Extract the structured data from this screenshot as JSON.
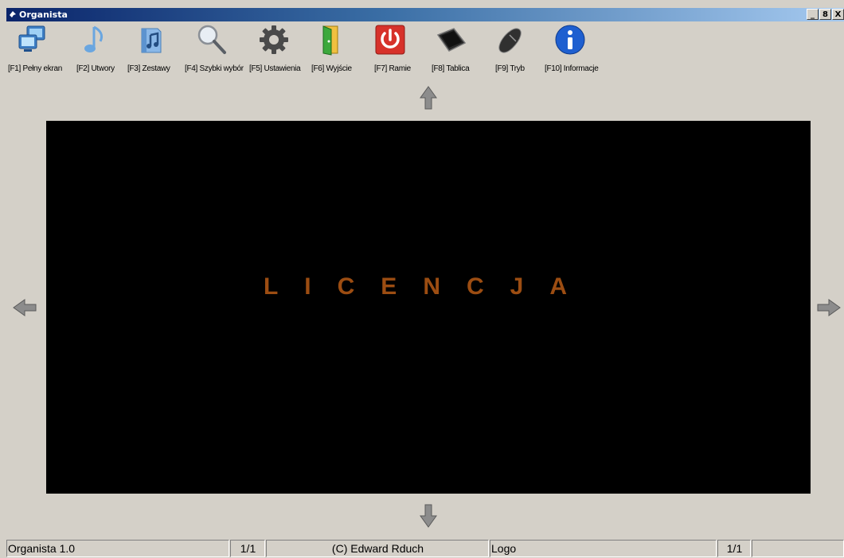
{
  "window": {
    "title": "Organista",
    "controls": {
      "minimize": "_",
      "maximize": "8",
      "close": "X"
    }
  },
  "toolbar": {
    "items": [
      {
        "label": "[F1] Pełny ekran",
        "icon": "monitors-icon"
      },
      {
        "label": "[F2] Utwory",
        "icon": "music-note-icon"
      },
      {
        "label": "[F3] Zestawy",
        "icon": "music-folder-icon"
      },
      {
        "label": "[F4] Szybki wybór",
        "icon": "magnifier-icon"
      },
      {
        "label": "[F5] Ustawienia",
        "icon": "gear-icon"
      },
      {
        "label": "[F6] Wyjście",
        "icon": "door-icon"
      },
      {
        "label": "[F7] Ramie",
        "icon": "power-icon"
      },
      {
        "label": "[F8] Tablica",
        "icon": "tablet-icon"
      },
      {
        "label": "[F9] Tryb",
        "icon": "mouse-icon"
      },
      {
        "label": "[F10] Informacje",
        "icon": "info-icon"
      }
    ]
  },
  "navigation": {
    "up": "arrow-up-icon",
    "down": "arrow-down-icon",
    "left": "arrow-left-icon",
    "right": "arrow-right-icon"
  },
  "screen": {
    "text": "LICENCJA",
    "text_color": "#9c4d12",
    "background": "#000000"
  },
  "status_bar": {
    "app_name": "Organista 1.0",
    "page_left": "1/1",
    "copyright": "(C) Edward Rduch",
    "logo": "Logo",
    "page_right": "1/1",
    "extra": ""
  },
  "colors": {
    "chrome": "#d4d0c8",
    "title_gradient_start": "#0a246a",
    "title_gradient_end": "#a6caf0"
  }
}
